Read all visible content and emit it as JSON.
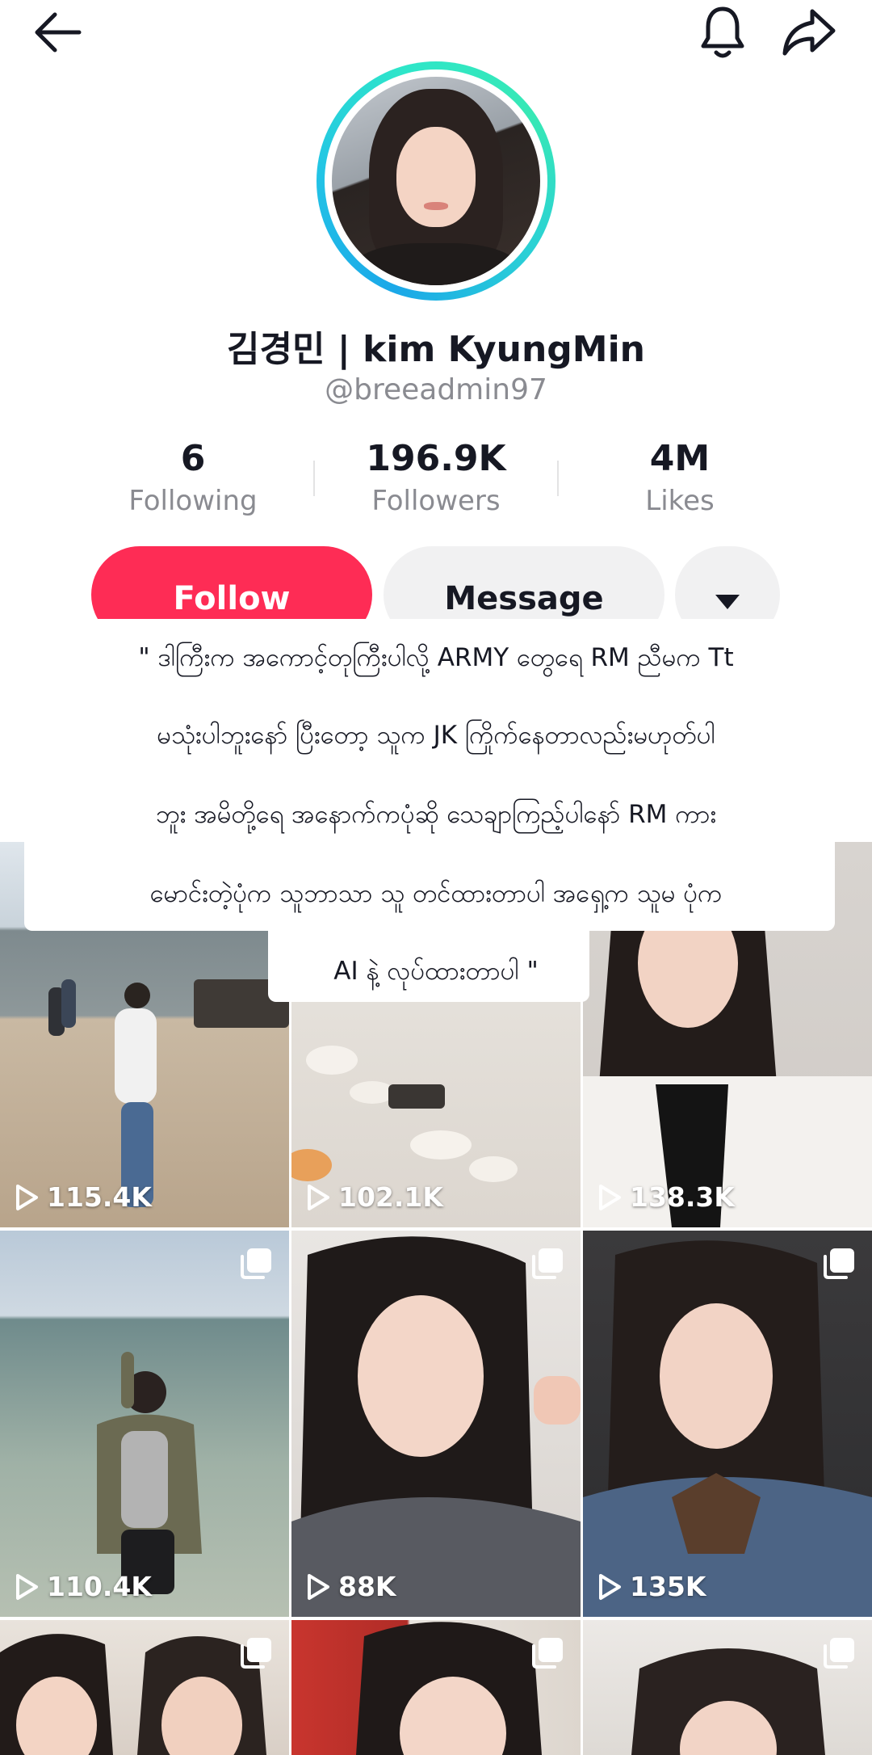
{
  "profile": {
    "display_name": "김경민 | kim KyungMin",
    "handle": "@breeadmin97"
  },
  "stats": {
    "following_count": "6",
    "following_label": "Following",
    "followers_count": "196.9K",
    "followers_label": "Followers",
    "likes_count": "4M",
    "likes_label": "Likes"
  },
  "actions": {
    "follow_label": "Follow",
    "message_label": "Message"
  },
  "bio": {
    "lines": [
      "\" ဒါကြီးက အကောင့်တုကြီးပါလို့ ARMY တွေရေ RM ညီမက Tt",
      "မသုံးပါဘူးနော် ပြီးတော့ သူက JK ကြိုက်နေတာလည်းမဟုတ်ပါ",
      "ဘူး အမိတို့ရေ အနောက်ကပုံဆို သေချာကြည့်ပါနော် RM ကား",
      "မောင်းတဲ့ပုံက သူဘာသာ သူ တင်ထားတာပါ အရှေ့က သူမ ပုံက",
      "AI နဲ့ လုပ်ထားတာပါ \""
    ]
  },
  "videos": [
    {
      "views": "115.4K"
    },
    {
      "views": "102.1K"
    },
    {
      "views": "138.3K"
    },
    {
      "views": "110.4K"
    },
    {
      "views": "88K"
    },
    {
      "views": "135K"
    }
  ],
  "colors": {
    "follow_button": "#fe2c55",
    "secondary_button": "#f1f1f2",
    "muted_text": "#8a8b91"
  },
  "icons": {
    "back": "arrow-left-icon",
    "notifications": "bell-icon",
    "share": "share-arrow-icon",
    "more": "triangle-down-icon",
    "play": "play-icon",
    "multi_photo": "multi-photo-icon"
  }
}
